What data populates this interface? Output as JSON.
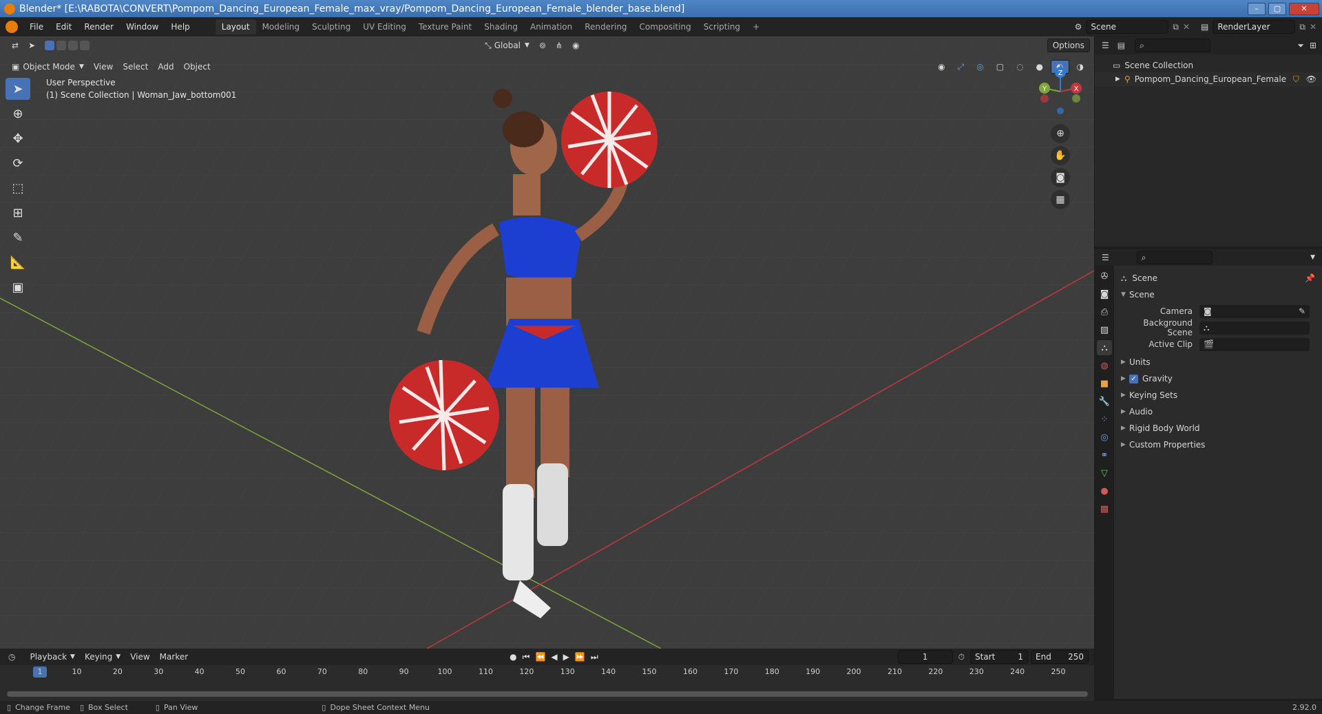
{
  "window": {
    "title": "Blender* [E:\\RABOTA\\CONVERT\\Pompom_Dancing_European_Female_max_vray/Pompom_Dancing_European_Female_blender_base.blend]",
    "minimize": "–",
    "maximize": "▢",
    "close": "✕"
  },
  "menu": [
    "File",
    "Edit",
    "Render",
    "Window",
    "Help"
  ],
  "workspaces": [
    "Layout",
    "Modeling",
    "Sculpting",
    "UV Editing",
    "Texture Paint",
    "Shading",
    "Animation",
    "Rendering",
    "Compositing",
    "Scripting"
  ],
  "workspace_add": "+",
  "scene_field": "Scene",
  "renderlayer_field": "RenderLayer",
  "viewport": {
    "mode": "Object Mode",
    "menus": [
      "View",
      "Select",
      "Add",
      "Object"
    ],
    "orientation": "Global",
    "options": "Options",
    "info_line1": "User Perspective",
    "info_line2": "(1) Scene Collection | Woman_Jaw_bottom001",
    "gizmo_z": "Z",
    "gizmo_y": "Y",
    "gizmo_x": "X"
  },
  "outliner": {
    "root": "Scene Collection",
    "child": "Pompom_Dancing_European_Female"
  },
  "properties": {
    "header": "Scene",
    "panel": "Scene",
    "camera_label": "Camera",
    "background_label": "Background Scene",
    "clip_label": "Active Clip",
    "sections": [
      "Units",
      "Gravity",
      "Keying Sets",
      "Audio",
      "Rigid Body World",
      "Custom Properties"
    ],
    "gravity_checked": true
  },
  "timeline": {
    "menus": [
      "Playback",
      "Keying",
      "View",
      "Marker"
    ],
    "current_frame": "1",
    "start_label": "Start",
    "start_value": "1",
    "end_label": "End",
    "end_value": "250",
    "ticks": [
      "1",
      "10",
      "20",
      "30",
      "40",
      "50",
      "60",
      "70",
      "80",
      "90",
      "100",
      "110",
      "120",
      "130",
      "140",
      "150",
      "160",
      "170",
      "180",
      "190",
      "200",
      "210",
      "220",
      "230",
      "240",
      "250"
    ]
  },
  "status": {
    "change_frame": "Change Frame",
    "box_select": "Box Select",
    "pan_view": "Pan View",
    "context_menu": "Dope Sheet Context Menu",
    "version": "2.92.0"
  },
  "colors": {
    "accent_blue": "#4772b3",
    "title_blue": "#3a6fb0",
    "x_axis": "#c0393f",
    "y_axis": "#7ea63a",
    "z_axis": "#2f7bd6"
  }
}
